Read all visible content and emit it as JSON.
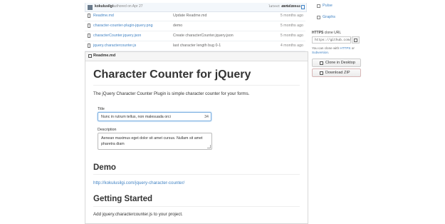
{
  "commit": {
    "author": "kokulusilgi",
    "authored": "authored on Apr 27",
    "latest_label": "latest commit",
    "hash": "457bf28044"
  },
  "files": [
    {
      "name": "Readme.md",
      "message": "Update Readme.md",
      "age": "5 months ago"
    },
    {
      "name": "character-counter-plugin-jquery.png",
      "message": "demo",
      "age": "5 months ago"
    },
    {
      "name": "characterCounter.jquery.json",
      "message": "Create characterCounter.jquery.json",
      "age": "5 months ago"
    },
    {
      "name": "jquery.charactercounter.js",
      "message": "last character length bug 0-1",
      "age": "4 months ago"
    }
  ],
  "readme": {
    "label": "Readme.md",
    "title": "Character Counter for jQuery",
    "intro": "The jQuery Character Counter Plugin is simple character counter for your forms.",
    "title_label": "Title",
    "title_value": "Nunc in rutrum tellus, non malesuada orci",
    "title_counter": "34",
    "desc_label": "Description",
    "desc_value": "Aenean maximus eget dolor sit amet cursus. Nullam sit amet pharetra diam",
    "demo_heading": "Demo",
    "demo_link": "http://kokulusilgi.com/jquery-character-counter/",
    "gs_heading": "Getting Started",
    "gs_text": "Add jquery.charactercounter.js to your project."
  },
  "sidebar": {
    "pulse": "Pulse",
    "graphs": "Graphs",
    "clone_label_bold": "HTTPS",
    "clone_label_rest": "clone URL",
    "clone_url": "https://github.com/",
    "clone_note_pre": "You can clone with",
    "clone_note_https": "HTTPS",
    "clone_note_or": "or",
    "clone_note_subversion": "Subversion",
    "clone_desktop": "Clone in Desktop",
    "download_zip": "Download ZIP"
  }
}
